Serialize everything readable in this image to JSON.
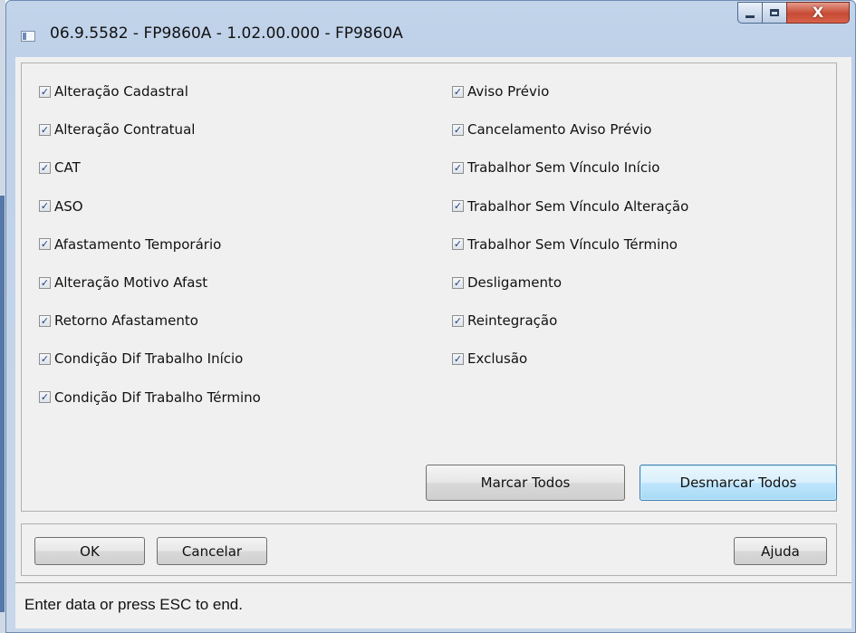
{
  "window": {
    "title": "06.9.5582 - FP9860A - 1.02.00.000 - FP9860A",
    "close_glyph": "X",
    "icons": {
      "app": "app-window-icon",
      "minimize": "minimize-icon",
      "maximize": "maximize-icon",
      "close": "close-icon"
    }
  },
  "checklist": {
    "left": [
      {
        "label": "Alteração Cadastral",
        "checked": true
      },
      {
        "label": "Alteração Contratual",
        "checked": true
      },
      {
        "label": "CAT",
        "checked": true
      },
      {
        "label": "ASO",
        "checked": true
      },
      {
        "label": "Afastamento Temporário",
        "checked": true
      },
      {
        "label": "Alteração Motivo Afast",
        "checked": true
      },
      {
        "label": "Retorno Afastamento",
        "checked": true
      },
      {
        "label": "Condição Dif Trabalho Início",
        "checked": true
      },
      {
        "label": "Condição Dif Trabalho Término",
        "checked": true
      }
    ],
    "right": [
      {
        "label": "Aviso Prévio",
        "checked": true
      },
      {
        "label": "Cancelamento Aviso Prévio",
        "checked": true
      },
      {
        "label": "Trabalhor Sem Vínculo Início",
        "checked": true
      },
      {
        "label": "Trabalhor Sem Vínculo Alteração",
        "checked": true
      },
      {
        "label": "Trabalhor Sem Vínculo Término",
        "checked": true
      },
      {
        "label": "Desligamento",
        "checked": true
      },
      {
        "label": "Reintegração",
        "checked": true
      },
      {
        "label": "Exclusão",
        "checked": true
      }
    ]
  },
  "buttons": {
    "mark_all": "Marcar Todos",
    "unmark_all": "Desmarcar Todos",
    "ok": "OK",
    "cancel": "Cancelar",
    "help": "Ajuda"
  },
  "status": {
    "text": "Enter data or press ESC to end."
  }
}
